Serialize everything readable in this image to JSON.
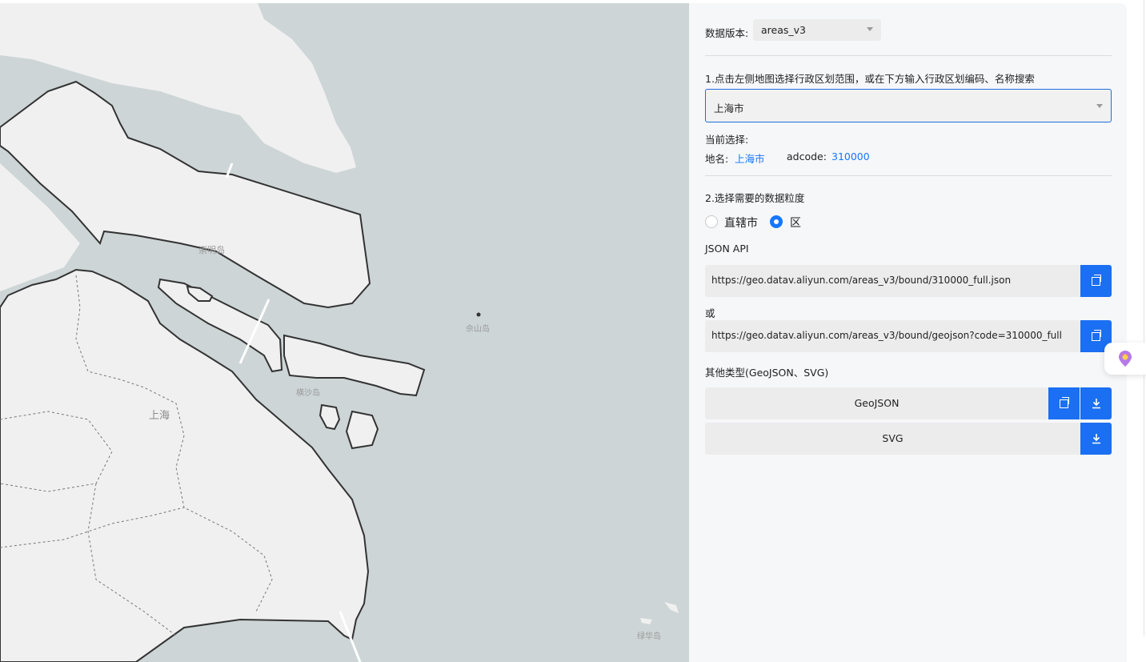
{
  "map": {
    "labels": {
      "chongming": "崇明岛",
      "sheshan": "佘山岛",
      "hengsha": "横沙岛",
      "shanghai": "上海",
      "lvhua": "绿华岛"
    }
  },
  "panel": {
    "version_label": "数据版本:",
    "version_value": "areas_v3",
    "step1_text": "1.点击左侧地图选择行政区划范围，或在下方输入行政区划编码、名称搜索",
    "region_value": "上海市",
    "current_label": "当前选择:",
    "name_label": "地名:",
    "name_value": "上海市",
    "adcode_label": "adcode:",
    "adcode_value": "310000",
    "step2_text": "2.选择需要的数据粒度",
    "granularity": [
      {
        "label": "直辖市",
        "checked": false
      },
      {
        "label": "区",
        "checked": true
      }
    ],
    "json_api_label": "JSON API",
    "api_url_1": "https://geo.datav.aliyun.com/areas_v3/bound/310000_full.json",
    "or_label": "或",
    "api_url_2": "https://geo.datav.aliyun.com/areas_v3/bound/geojson?code=310000_full",
    "other_types_label": "其他类型(GeoJSON、SVG)",
    "geojson_label": "GeoJSON",
    "svg_label": "SVG"
  },
  "colors": {
    "accent": "#1677ff",
    "button_blue": "#1b6ff2",
    "water": "#cdd5d6",
    "land": "#f0f0f0"
  }
}
